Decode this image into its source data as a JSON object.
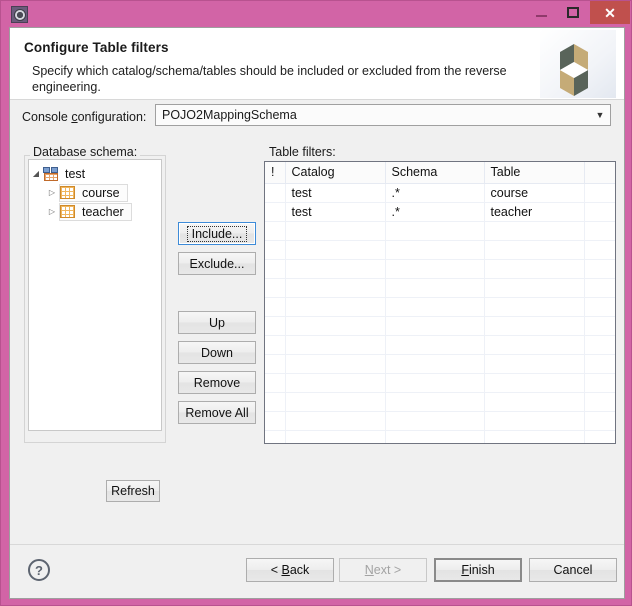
{
  "window": {
    "icon": "gear-icon",
    "controls": {
      "minimize": "minimize-icon",
      "maximize": "maximize-icon",
      "close": "✕"
    },
    "titlebar_color": "#d264a6",
    "close_button_color": "#c0504d"
  },
  "header": {
    "title": "Configure Table filters",
    "description": "Specify which catalog/schema/tables should be included or excluded from the reverse engineering.",
    "logo": {
      "name": "hibernate-hexagon-logo",
      "dark_color": "#59645a",
      "light_color": "#c5ab77"
    }
  },
  "config": {
    "label_pre": "Console ",
    "label_accel": "c",
    "label_post": "onfiguration:",
    "value": "POJO2MappingSchema",
    "arrow": "▼"
  },
  "schema_group": {
    "legend": "Database schema:",
    "tree": [
      {
        "label": "test",
        "level": 0,
        "twisty": "◢",
        "icon": "database-schema-icon",
        "expanded": true
      },
      {
        "label": "course",
        "level": 1,
        "twisty": "▷",
        "icon": "table-icon",
        "expanded": false
      },
      {
        "label": "teacher",
        "level": 1,
        "twisty": "▷",
        "icon": "table-icon",
        "expanded": false
      }
    ]
  },
  "buttons": {
    "include": "Include...",
    "exclude": "Exclude...",
    "up": "Up",
    "down": "Down",
    "remove": "Remove",
    "remove_all": "Remove All",
    "refresh": "Refresh"
  },
  "filters_group": {
    "legend": "Table filters:",
    "columns": [
      "!",
      "Catalog",
      "Schema",
      "Table",
      ""
    ],
    "rows": [
      [
        "",
        "test",
        ".*",
        "course",
        ""
      ],
      [
        "",
        "test",
        ".*",
        "teacher",
        ""
      ]
    ],
    "empty_row_count": 12
  },
  "bottom": {
    "help": "?",
    "back_pre": "< ",
    "back_accel": "B",
    "back_post": "ack",
    "next_accel": "N",
    "next_post": "ext >",
    "finish_accel": "F",
    "finish_post": "inish",
    "cancel": "Cancel",
    "next_enabled": false
  }
}
